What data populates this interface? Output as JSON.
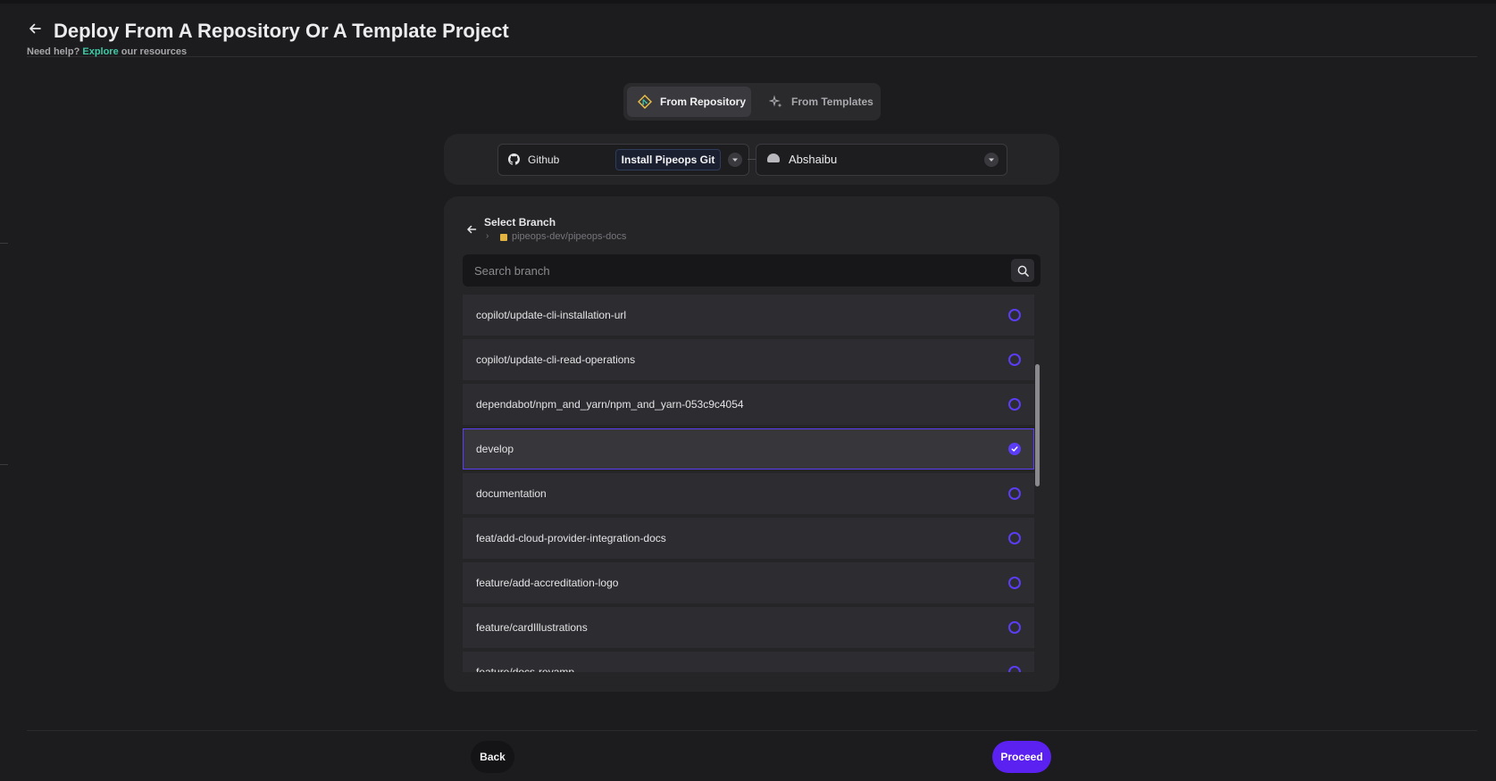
{
  "header": {
    "title": "Deploy From A Repository Or A Template Project",
    "help_prefix": "Need help?",
    "help_link": "Explore",
    "help_suffix": "our resources"
  },
  "source_tabs": [
    {
      "label": "From Repository",
      "active": true,
      "icon": "git-diamond-icon"
    },
    {
      "label": "From Templates",
      "active": false,
      "icon": "sparkle-icon"
    }
  ],
  "provider": {
    "label": "Github",
    "icon": "github-icon",
    "install_label": "Install Pipeops Git"
  },
  "account": {
    "name": "Abshaibu"
  },
  "branch_panel": {
    "title": "Select Branch",
    "repo": "pipeops-dev/pipeops-docs",
    "search_placeholder": "Search branch"
  },
  "branches": [
    {
      "name": "copilot/update-cli-installation-url",
      "selected": false
    },
    {
      "name": "copilot/update-cli-read-operations",
      "selected": false
    },
    {
      "name": "dependabot/npm_and_yarn/npm_and_yarn-053c9c4054",
      "selected": false
    },
    {
      "name": "develop",
      "selected": true
    },
    {
      "name": "documentation",
      "selected": false
    },
    {
      "name": "feat/add-cloud-provider-integration-docs",
      "selected": false
    },
    {
      "name": "feature/add-accreditation-logo",
      "selected": false
    },
    {
      "name": "feature/cardIllustrations",
      "selected": false
    },
    {
      "name": "feature/docs-revamp",
      "selected": false
    }
  ],
  "footer": {
    "back_label": "Back",
    "proceed_label": "Proceed"
  },
  "colors": {
    "accent": "#5b3df5",
    "proceed": "#5b21f0",
    "link": "#3ec9a7",
    "background": "#1c1c1e"
  }
}
